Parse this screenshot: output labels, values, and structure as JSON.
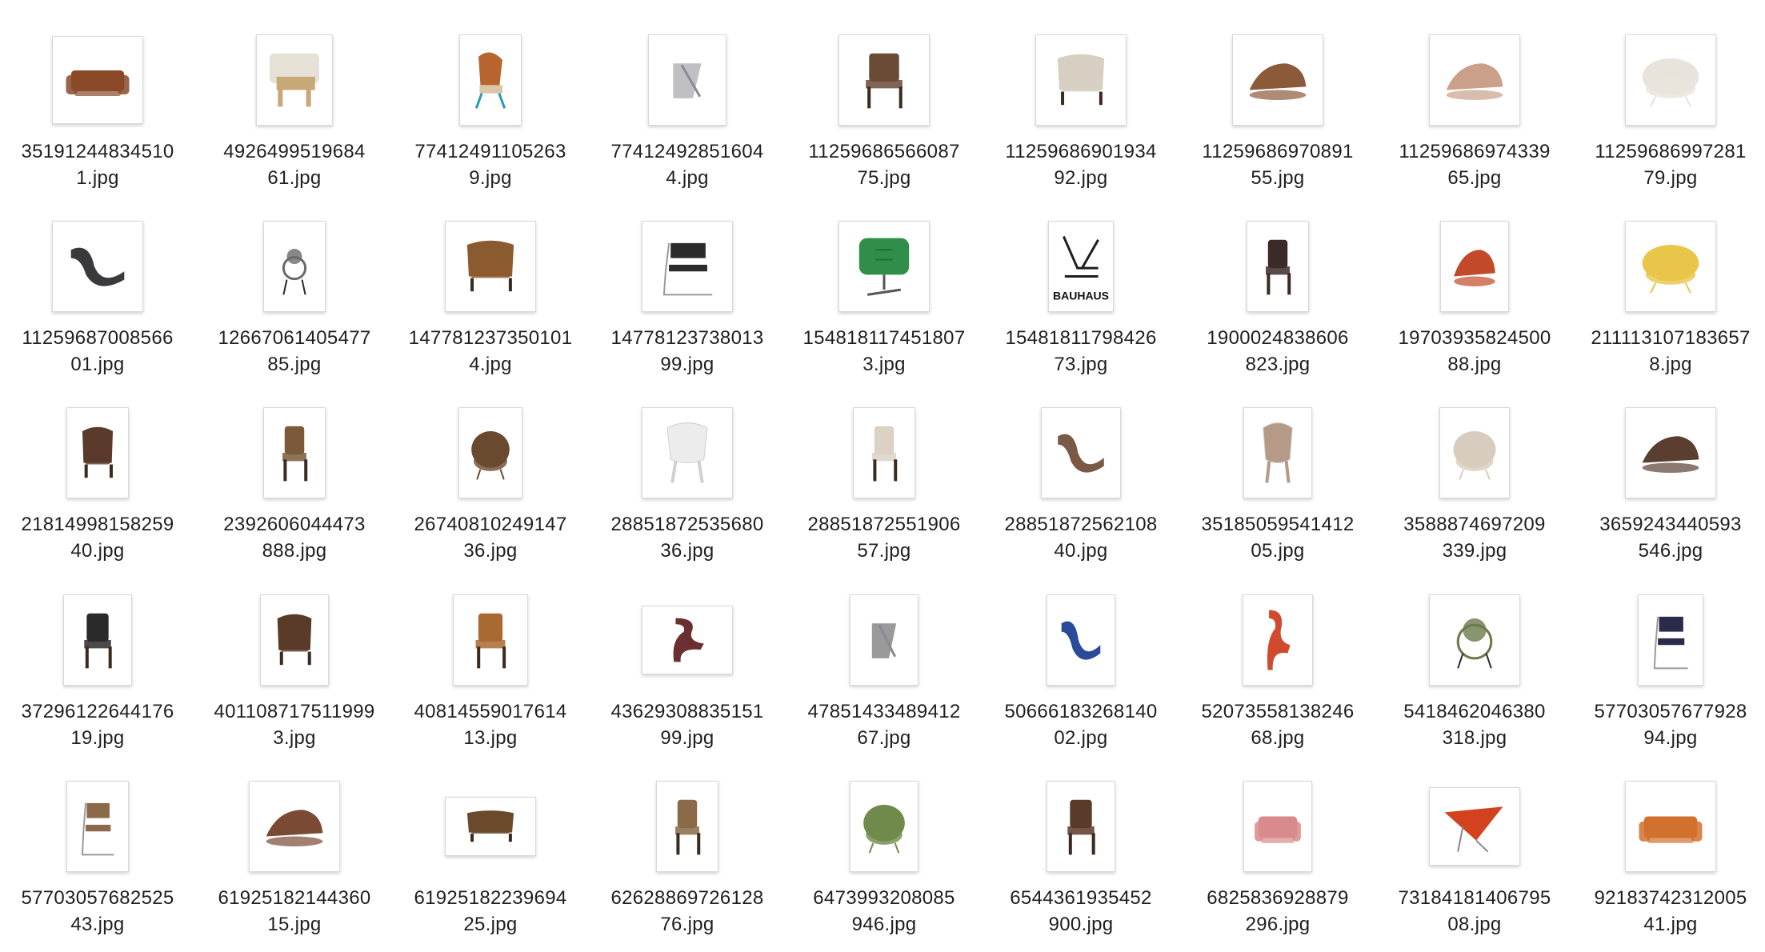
{
  "window": {
    "title": ""
  },
  "files": [
    {
      "line1": "35191244834510",
      "line2": "1.jpg",
      "icon": "leather-club-chair-icon",
      "color": "#8a4a2a",
      "shape": "club"
    },
    {
      "line1": "4926499519684",
      "line2": "61.jpg",
      "icon": "wooden-lounge-chair-icon",
      "color": "#c9a877",
      "shape": "block"
    },
    {
      "line1": "77412491105263",
      "line2": "9.jpg",
      "icon": "wingback-chair-icon",
      "color": "#b8642e",
      "shape": "wing"
    },
    {
      "line1": "77412492851604",
      "line2": "4.jpg",
      "icon": "twisted-stool-icon",
      "color": "#bfbfc4",
      "shape": "stool"
    },
    {
      "line1": "11259686566087",
      "line2": "75.jpg",
      "icon": "dining-chair-icon",
      "color": "#6b4a36",
      "shape": "dining"
    },
    {
      "line1": "11259686901934",
      "line2": "92.jpg",
      "icon": "upholstered-armchair-icon",
      "color": "#d7cfc2",
      "shape": "arm"
    },
    {
      "line1": "11259686970891",
      "line2": "55.jpg",
      "icon": "rocking-lounge-chair-icon",
      "color": "#8a5a3a",
      "shape": "lounge"
    },
    {
      "line1": "11259686974339",
      "line2": "65.jpg",
      "icon": "shell-lounge-chair-icon",
      "color": "#caa08a",
      "shape": "lounge"
    },
    {
      "line1": "11259686997281",
      "line2": "79.jpg",
      "icon": "boucle-armchair-icon",
      "color": "#e8e4dc",
      "shape": "puff"
    },
    {
      "line1": "11259687008566",
      "line2": "01.jpg",
      "icon": "curved-lounge-chair-icon",
      "color": "#3a3a3c",
      "shape": "curve"
    },
    {
      "line1": "12667061405477",
      "line2": "85.jpg",
      "icon": "sculptural-chair-icon",
      "color": "#6a6a6a",
      "shape": "sphere"
    },
    {
      "line1": "147781237350101",
      "line2": "4.jpg",
      "icon": "wooden-armchair-icon",
      "color": "#8b5a2f",
      "shape": "arm"
    },
    {
      "line1": "14778123738013",
      "line2": "99.jpg",
      "icon": "cantilever-chair-icon",
      "color": "#2b2b2b",
      "shape": "cantilever"
    },
    {
      "line1": "154818117451807",
      "line2": "3.jpg",
      "icon": "green-swivel-chair-icon",
      "color": "#2f8f4a",
      "shape": "swivel"
    },
    {
      "line1": "15481811798426",
      "line2": "73.jpg",
      "icon": "bauhaus-poster-icon",
      "color": "#1e1e1e",
      "shape": "bauhaus"
    },
    {
      "line1": "1900024838606",
      "line2": "823.jpg",
      "icon": "round-back-chair-icon",
      "color": "#3b2a2a",
      "shape": "dining"
    },
    {
      "line1": "19703935824500",
      "line2": "88.jpg",
      "icon": "red-lounge-chair-icon",
      "color": "#c24a2a",
      "shape": "lounge"
    },
    {
      "line1": "211113107183657",
      "line2": "8.jpg",
      "icon": "yellow-lounge-chair-icon",
      "color": "#e8c64a",
      "shape": "puff"
    },
    {
      "line1": "21814998158259",
      "line2": "40.jpg",
      "icon": "sling-armchair-icon",
      "color": "#5a3a2a",
      "shape": "arm"
    },
    {
      "line1": "2392606044473",
      "line2": "888.jpg",
      "icon": "tall-back-chair-icon",
      "color": "#7a5a3a",
      "shape": "dining"
    },
    {
      "line1": "26740810249147",
      "line2": "36.jpg",
      "icon": "egg-chair-icon",
      "color": "#6a4a2e",
      "shape": "puff"
    },
    {
      "line1": "28851872535680",
      "line2": "36.jpg",
      "icon": "white-shell-chair-icon",
      "color": "#ececec",
      "shape": "shell"
    },
    {
      "line1": "28851872551906",
      "line2": "57.jpg",
      "icon": "round-back-dining-chair-icon",
      "color": "#dcd2c4",
      "shape": "dining"
    },
    {
      "line1": "28851872562108",
      "line2": "40.jpg",
      "icon": "wiggle-chair-icon",
      "color": "#7a5a44",
      "shape": "curve"
    },
    {
      "line1": "35185059541412",
      "line2": "05.jpg",
      "icon": "glass-chair-icon",
      "color": "#b59a88",
      "shape": "shell"
    },
    {
      "line1": "3588874697209",
      "line2": "339.jpg",
      "icon": "barrel-chair-icon",
      "color": "#d8ccbe",
      "shape": "puff"
    },
    {
      "line1": "3659243440593",
      "line2": "546.jpg",
      "icon": "abstract-lounge-icon",
      "color": "#5a3e30",
      "shape": "lounge"
    },
    {
      "line1": "37296122644176",
      "line2": "19.jpg",
      "icon": "angular-chair-icon",
      "color": "#2a2a2a",
      "shape": "dining"
    },
    {
      "line1": "401108717511999",
      "line2": "3.jpg",
      "icon": "folding-chair-icon",
      "color": "#5a3a28",
      "shape": "arm"
    },
    {
      "line1": "40814559017614",
      "line2": "13.jpg",
      "icon": "stool-chair-icon",
      "color": "#a86a30",
      "shape": "dining"
    },
    {
      "line1": "43629308835151",
      "line2": "99.jpg",
      "icon": "s-chair-icon",
      "color": "#6a3030",
      "shape": "scurve"
    },
    {
      "line1": "47851433489412",
      "line2": "67.jpg",
      "icon": "geometric-chair-icon",
      "color": "#9a9a9a",
      "shape": "stool"
    },
    {
      "line1": "50666183268140",
      "line2": "02.jpg",
      "icon": "blue-wave-chair-icon",
      "color": "#2a4a9a",
      "shape": "curve"
    },
    {
      "line1": "52073558138246",
      "line2": "68.jpg",
      "icon": "red-s-chair-icon",
      "color": "#d14a30",
      "shape": "scurve"
    },
    {
      "line1": "5418462046380",
      "line2": "318.jpg",
      "icon": "ring-chair-icon",
      "color": "#6a7a4a",
      "shape": "sphere"
    },
    {
      "line1": "57703057677928",
      "line2": "94.jpg",
      "icon": "tubular-chair-icon",
      "color": "#2a2a4a",
      "shape": "cantilever"
    },
    {
      "line1": "57703057682525",
      "line2": "43.jpg",
      "icon": "frame-lounge-chair-icon",
      "color": "#8a6a4a",
      "shape": "cantilever"
    },
    {
      "line1": "61925182144360",
      "line2": "15.jpg",
      "icon": "reclining-chair-icon",
      "color": "#7a4a34",
      "shape": "lounge"
    },
    {
      "line1": "61925182239694",
      "line2": "25.jpg",
      "icon": "sculpted-wood-chair-icon",
      "color": "#6a4a2a",
      "shape": "arm"
    },
    {
      "line1": "62628869726128",
      "line2": "76.jpg",
      "icon": "minimal-wood-chair-icon",
      "color": "#8a6a48",
      "shape": "dining"
    },
    {
      "line1": "6473993208085",
      "line2": "946.jpg",
      "icon": "moss-chair-icon",
      "color": "#6f8a4a",
      "shape": "puff"
    },
    {
      "line1": "6544361935452",
      "line2": "900.jpg",
      "icon": "plain-wood-chair-icon",
      "color": "#5a3a28",
      "shape": "dining"
    },
    {
      "line1": "6825836928879",
      "line2": "296.jpg",
      "icon": "pink-armchair-icon",
      "color": "#d98a8a",
      "shape": "club"
    },
    {
      "line1": "73184181406795",
      "line2": "08.jpg",
      "icon": "red-origami-chair-icon",
      "color": "#d2421f",
      "shape": "origami"
    },
    {
      "line1": "92183742312005",
      "line2": "41.jpg",
      "icon": "orange-armchair-icon",
      "color": "#d2702e",
      "shape": "club"
    }
  ]
}
